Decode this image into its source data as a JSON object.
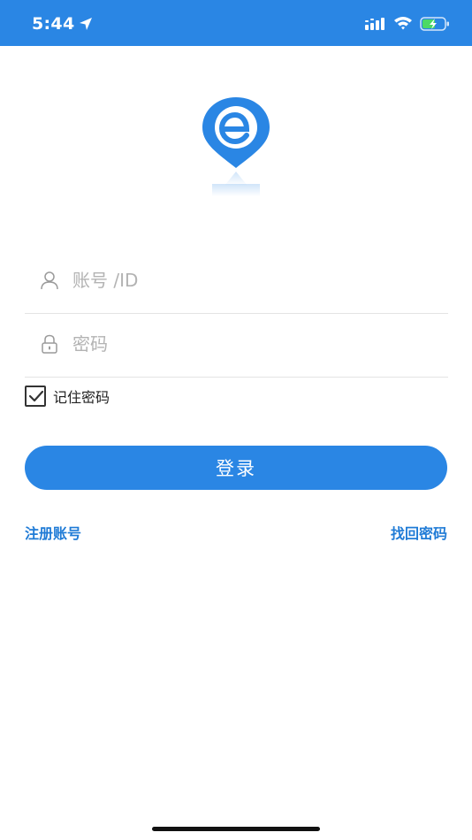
{
  "status_bar": {
    "time": "5:44",
    "bg_color": "#2a86e4",
    "icons": [
      "location-arrow-icon",
      "signal-icon",
      "wifi-icon",
      "battery-charging-icon"
    ]
  },
  "logo": {
    "icon": "e-location-pin-logo",
    "color": "#2a86e4"
  },
  "form": {
    "account": {
      "placeholder": "账号 /ID",
      "value": "",
      "icon": "user-icon"
    },
    "password": {
      "placeholder": "密码",
      "value": "",
      "icon": "lock-icon"
    },
    "remember": {
      "label": "记住密码",
      "checked": true
    },
    "login_label": "登录"
  },
  "links": {
    "register": "注册账号",
    "forgot_password": "找回密码"
  },
  "colors": {
    "accent": "#2a86e4",
    "link": "#1f7bd6"
  }
}
